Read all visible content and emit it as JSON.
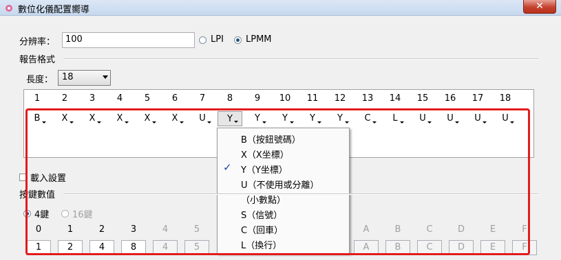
{
  "window": {
    "title": "數位化儀配置嚮導",
    "close_label": "✕"
  },
  "resolution": {
    "label": "分辨率：",
    "value": "100",
    "option_lpi": "LPI",
    "option_lpmm": "LPMM",
    "selected": "LPMM"
  },
  "report": {
    "group_label": "報告格式",
    "length_label": "長度：",
    "length_value": "18"
  },
  "columns": [
    "1",
    "2",
    "3",
    "4",
    "5",
    "6",
    "7",
    "8",
    "9",
    "10",
    "11",
    "12",
    "13",
    "14",
    "15",
    "16",
    "17",
    "18"
  ],
  "cells": [
    "B",
    "X",
    "X",
    "X",
    "X",
    "X",
    "U",
    "Y",
    "Y",
    "Y",
    "Y",
    "Y",
    "C",
    "L",
    "U",
    "U",
    "U",
    "U"
  ],
  "selected_cell": 8,
  "dropdown": {
    "items": [
      "B（按鈕號碼）",
      "X（X坐標）",
      "Y（Y坐標）",
      "U（不使用或分離）",
      "（小數點）",
      "S（信號）",
      "C（回車）",
      "L（換行）"
    ],
    "checked_index": 2,
    "check_mark": "✓"
  },
  "load_settings": {
    "label": "載入設置"
  },
  "keys": {
    "group_label": "按鍵數值",
    "option_4": "4鍵",
    "option_16": "16鍵",
    "headers": [
      "0",
      "1",
      "2",
      "3",
      "4",
      "5",
      "A",
      "B",
      "C",
      "D",
      "E",
      "F"
    ],
    "values": [
      "1",
      "2",
      "4",
      "8",
      "4",
      "5",
      "A",
      "B",
      "C",
      "D",
      "E",
      "F"
    ]
  },
  "colors": {
    "highlight": "#e21b1b",
    "check": "#1c3fa6"
  }
}
